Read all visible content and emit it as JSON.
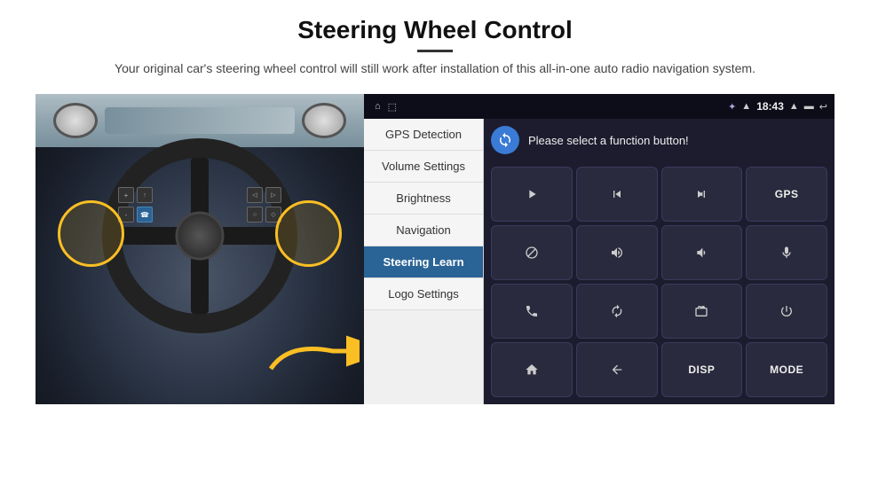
{
  "header": {
    "title": "Steering Wheel Control",
    "subtitle": "Your original car's steering wheel control will still work after installation of this all-in-one auto radio navigation system."
  },
  "statusBar": {
    "time": "18:43",
    "navIcons": [
      "⊏",
      "⬚"
    ],
    "rightIcons": [
      "⚡",
      "◈",
      "▲",
      "▬",
      "↩"
    ]
  },
  "menu": {
    "items": [
      {
        "label": "GPS Detection",
        "active": false
      },
      {
        "label": "Volume Settings",
        "active": false
      },
      {
        "label": "Brightness",
        "active": false
      },
      {
        "label": "Navigation",
        "active": false
      },
      {
        "label": "Steering Learn",
        "active": true
      },
      {
        "label": "Logo Settings",
        "active": false
      }
    ]
  },
  "functionPanel": {
    "prompt": "Please select a function button!",
    "buttons": [
      {
        "icon": "▶",
        "label": ""
      },
      {
        "icon": "⏮",
        "label": ""
      },
      {
        "icon": "⏭",
        "label": ""
      },
      {
        "icon": "GPS",
        "label": "GPS",
        "isText": true
      },
      {
        "icon": "🚫",
        "label": ""
      },
      {
        "icon": "🔊+",
        "label": ""
      },
      {
        "icon": "🔊-",
        "label": ""
      },
      {
        "icon": "🎤",
        "label": ""
      },
      {
        "icon": "📞",
        "label": ""
      },
      {
        "icon": "↺",
        "label": ""
      },
      {
        "icon": "📻",
        "label": ""
      },
      {
        "icon": "⏻",
        "label": ""
      },
      {
        "icon": "🏠",
        "label": ""
      },
      {
        "icon": "↩",
        "label": ""
      },
      {
        "icon": "DISP",
        "label": "DISP",
        "isText": true
      },
      {
        "icon": "MODE",
        "label": "MODE",
        "isText": true
      }
    ]
  }
}
